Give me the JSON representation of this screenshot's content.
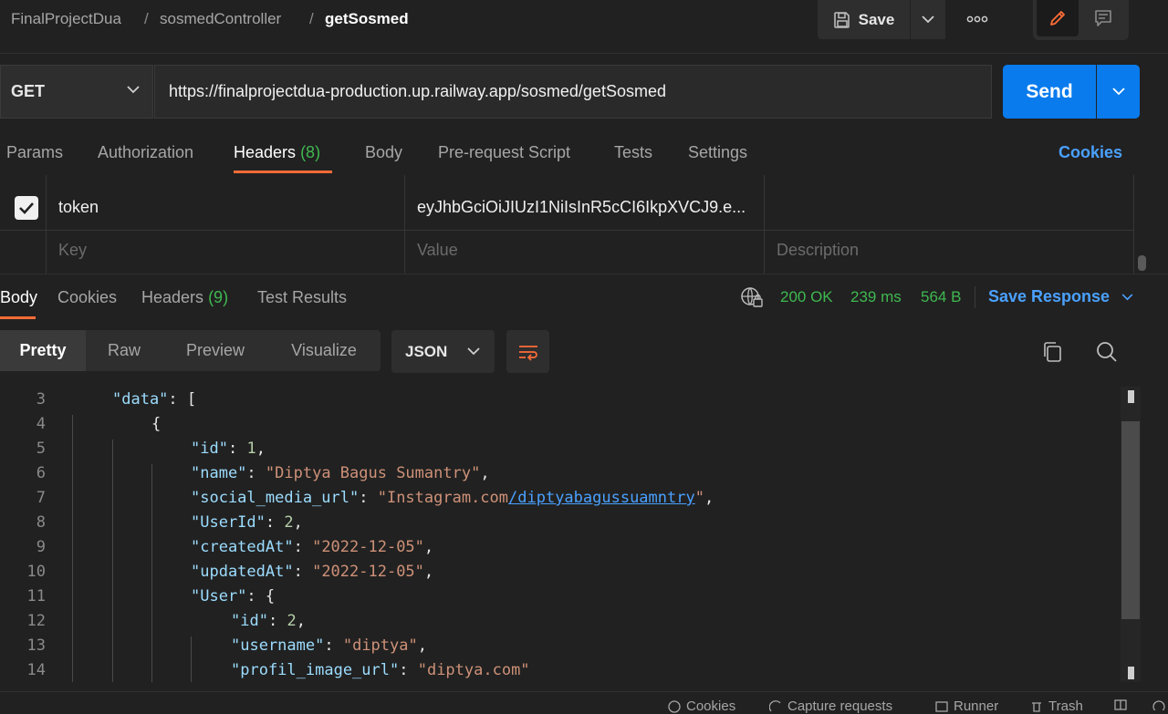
{
  "breadcrumb": {
    "collection": "FinalProjectDua",
    "folder": "sosmedController",
    "request": "getSosmed",
    "separator": "/"
  },
  "toolbar": {
    "save_label": "Save",
    "save_icon": "floppy-disk-icon",
    "more_icon": "ellipsis-icon",
    "edit_icon": "pencil-icon",
    "docs_icon": "comment-icon"
  },
  "request": {
    "method": "GET",
    "url": "https://finalprojectdua-production.up.railway.app/sosmed/getSosmed",
    "send_label": "Send"
  },
  "request_tabs": {
    "params": "Params",
    "authorization": "Authorization",
    "headers": "Headers",
    "headers_count": "(8)",
    "body": "Body",
    "prerequest": "Pre-request Script",
    "tests": "Tests",
    "settings": "Settings",
    "cookies": "Cookies"
  },
  "headers_table": {
    "rows": [
      {
        "enabled": true,
        "key": "token",
        "value": "eyJhbGciOiJIUzI1NiIsInR5cCI6IkpXVCJ9.e...",
        "description": ""
      }
    ],
    "placeholder": {
      "key": "Key",
      "value": "Value",
      "description": "Description"
    }
  },
  "response_tabs": {
    "body": "Body",
    "cookies": "Cookies",
    "headers": "Headers",
    "headers_count": "(9)",
    "test_results": "Test Results"
  },
  "response_status": {
    "code": "200 OK",
    "time": "239 ms",
    "size": "564 B",
    "save_response": "Save Response"
  },
  "view_modes": {
    "pretty": "Pretty",
    "raw": "Raw",
    "preview": "Preview",
    "visualize": "Visualize",
    "format": "JSON"
  },
  "code_lines": [
    {
      "num": "3",
      "tokens": [
        {
          "t": "k",
          "v": "\"data\""
        },
        {
          "t": "p",
          "v": ": ["
        }
      ]
    },
    {
      "num": "4",
      "tokens": [
        {
          "t": "p",
          "v": "{"
        }
      ]
    },
    {
      "num": "5",
      "tokens": [
        {
          "t": "k",
          "v": "\"id\""
        },
        {
          "t": "p",
          "v": ": "
        },
        {
          "t": "n",
          "v": "1"
        },
        {
          "t": "p",
          "v": ","
        }
      ]
    },
    {
      "num": "6",
      "tokens": [
        {
          "t": "k",
          "v": "\"name\""
        },
        {
          "t": "p",
          "v": ": "
        },
        {
          "t": "s",
          "v": "\"Diptya Bagus Sumantry\""
        },
        {
          "t": "p",
          "v": ","
        }
      ]
    },
    {
      "num": "7",
      "tokens": [
        {
          "t": "k",
          "v": "\"social_media_url\""
        },
        {
          "t": "p",
          "v": ": "
        },
        {
          "t": "s",
          "v": "\"Instagram.com"
        },
        {
          "t": "u",
          "v": "/diptyabagussuamntry"
        },
        {
          "t": "s",
          "v": "\""
        },
        {
          "t": "p",
          "v": ","
        }
      ]
    },
    {
      "num": "8",
      "tokens": [
        {
          "t": "k",
          "v": "\"UserId\""
        },
        {
          "t": "p",
          "v": ": "
        },
        {
          "t": "n",
          "v": "2"
        },
        {
          "t": "p",
          "v": ","
        }
      ]
    },
    {
      "num": "9",
      "tokens": [
        {
          "t": "k",
          "v": "\"createdAt\""
        },
        {
          "t": "p",
          "v": ": "
        },
        {
          "t": "s",
          "v": "\"2022-12-05\""
        },
        {
          "t": "p",
          "v": ","
        }
      ]
    },
    {
      "num": "10",
      "tokens": [
        {
          "t": "k",
          "v": "\"updatedAt\""
        },
        {
          "t": "p",
          "v": ": "
        },
        {
          "t": "s",
          "v": "\"2022-12-05\""
        },
        {
          "t": "p",
          "v": ","
        }
      ]
    },
    {
      "num": "11",
      "tokens": [
        {
          "t": "k",
          "v": "\"User\""
        },
        {
          "t": "p",
          "v": ": {"
        }
      ]
    },
    {
      "num": "12",
      "tokens": [
        {
          "t": "k",
          "v": "\"id\""
        },
        {
          "t": "p",
          "v": ": "
        },
        {
          "t": "n",
          "v": "2"
        },
        {
          "t": "p",
          "v": ","
        }
      ]
    },
    {
      "num": "13",
      "tokens": [
        {
          "t": "k",
          "v": "\"username\""
        },
        {
          "t": "p",
          "v": ": "
        },
        {
          "t": "s",
          "v": "\"diptya\""
        },
        {
          "t": "p",
          "v": ","
        }
      ]
    },
    {
      "num": "14",
      "tokens": [
        {
          "t": "k",
          "v": "\"profil_image_url\""
        },
        {
          "t": "p",
          "v": ": "
        },
        {
          "t": "s",
          "v": "\"diptya.com\""
        }
      ]
    }
  ],
  "footer": {
    "cookies": "Cookies",
    "capture": "Capture requests",
    "runner": "Runner",
    "trash": "Trash"
  },
  "colors": {
    "accent_orange": "#ff6c37",
    "send_blue": "#097bed",
    "link_blue": "#4aa1ff",
    "status_green": "#3fb950"
  }
}
